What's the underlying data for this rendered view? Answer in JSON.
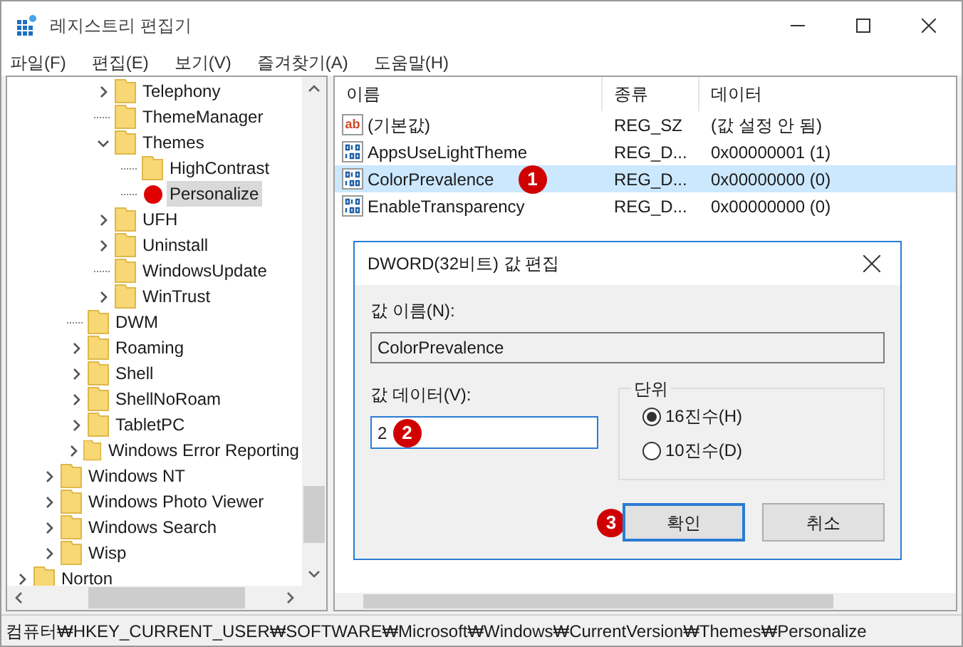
{
  "window": {
    "title": "레지스트리 편집기"
  },
  "menu": [
    "파일(F)",
    "편집(E)",
    "보기(V)",
    "즐겨찾기(A)",
    "도움말(H)"
  ],
  "tree": {
    "items": [
      {
        "kind": "hidden",
        "children": [
          {
            "kind": "hidden",
            "children": [
              {
                "kind": "hidden",
                "children": [
                  {
                    "label": "Telephony",
                    "kind": "collapsed",
                    "selected": false
                  },
                  {
                    "label": "ThemeManager",
                    "kind": "leaf",
                    "selected": false
                  },
                  {
                    "label": "Themes",
                    "kind": "expanded",
                    "selected": false,
                    "children": [
                      {
                        "label": "HighContrast",
                        "kind": "leaf",
                        "selected": false
                      },
                      {
                        "label": "Personalize",
                        "kind": "leaf",
                        "selected": true,
                        "marker_dot": true
                      }
                    ]
                  },
                  {
                    "label": "UFH",
                    "kind": "collapsed",
                    "selected": false
                  },
                  {
                    "label": "Uninstall",
                    "kind": "collapsed",
                    "selected": false
                  },
                  {
                    "label": "WindowsUpdate",
                    "kind": "leaf",
                    "selected": false
                  },
                  {
                    "label": "WinTrust",
                    "kind": "collapsed",
                    "selected": false
                  }
                ]
              },
              {
                "label": "DWM",
                "kind": "leaf",
                "selected": false
              },
              {
                "label": "Roaming",
                "kind": "collapsed",
                "selected": false
              },
              {
                "label": "Shell",
                "kind": "collapsed",
                "selected": false
              },
              {
                "label": "ShellNoRoam",
                "kind": "collapsed",
                "selected": false
              },
              {
                "label": "TabletPC",
                "kind": "collapsed",
                "selected": false
              },
              {
                "label": "Windows Error Reporting",
                "kind": "collapsed",
                "selected": false
              }
            ]
          },
          {
            "label": "Windows NT",
            "kind": "collapsed",
            "selected": false
          },
          {
            "label": "Windows Photo Viewer",
            "kind": "collapsed",
            "selected": false
          },
          {
            "label": "Windows Search",
            "kind": "collapsed",
            "selected": false
          },
          {
            "label": "Wisp",
            "kind": "collapsed",
            "selected": false
          }
        ]
      },
      {
        "label": "Norton",
        "kind": "collapsed",
        "selected": false
      }
    ]
  },
  "values": {
    "columns": [
      "이름",
      "종류",
      "데이터"
    ],
    "rows": [
      {
        "kind": "string",
        "icon_text": "ab",
        "name": "(기본값)",
        "type": "REG_SZ",
        "data": "(값 설정 안 됨)",
        "selected": false
      },
      {
        "kind": "dword",
        "name": "AppsUseLightTheme",
        "type": "REG_D...",
        "data": "0x00000001 (1)",
        "selected": false
      },
      {
        "kind": "dword",
        "name": "ColorPrevalence",
        "type": "REG_D...",
        "data": "0x00000000 (0)",
        "selected": true,
        "badge": "1"
      },
      {
        "kind": "dword",
        "name": "EnableTransparency",
        "type": "REG_D...",
        "data": "0x00000000 (0)",
        "selected": false
      }
    ]
  },
  "dialog": {
    "title": "DWORD(32비트) 값 편집",
    "name_label": "값 이름(N):",
    "name_value": "ColorPrevalence",
    "data_label": "값 데이터(V):",
    "data_value": "2",
    "data_badge": "2",
    "base_group": "단위",
    "bases": [
      {
        "label": "16진수(H)",
        "selected": true
      },
      {
        "label": "10진수(D)",
        "selected": false
      }
    ],
    "buttons": [
      {
        "label": "확인",
        "default": true,
        "badge": "3"
      },
      {
        "label": "취소",
        "default": false
      }
    ]
  },
  "status_bar": "컴퓨터₩HKEY_CURRENT_USER₩SOFTWARE₩Microsoft₩Windows₩CurrentVersion₩Themes₩Personalize"
}
